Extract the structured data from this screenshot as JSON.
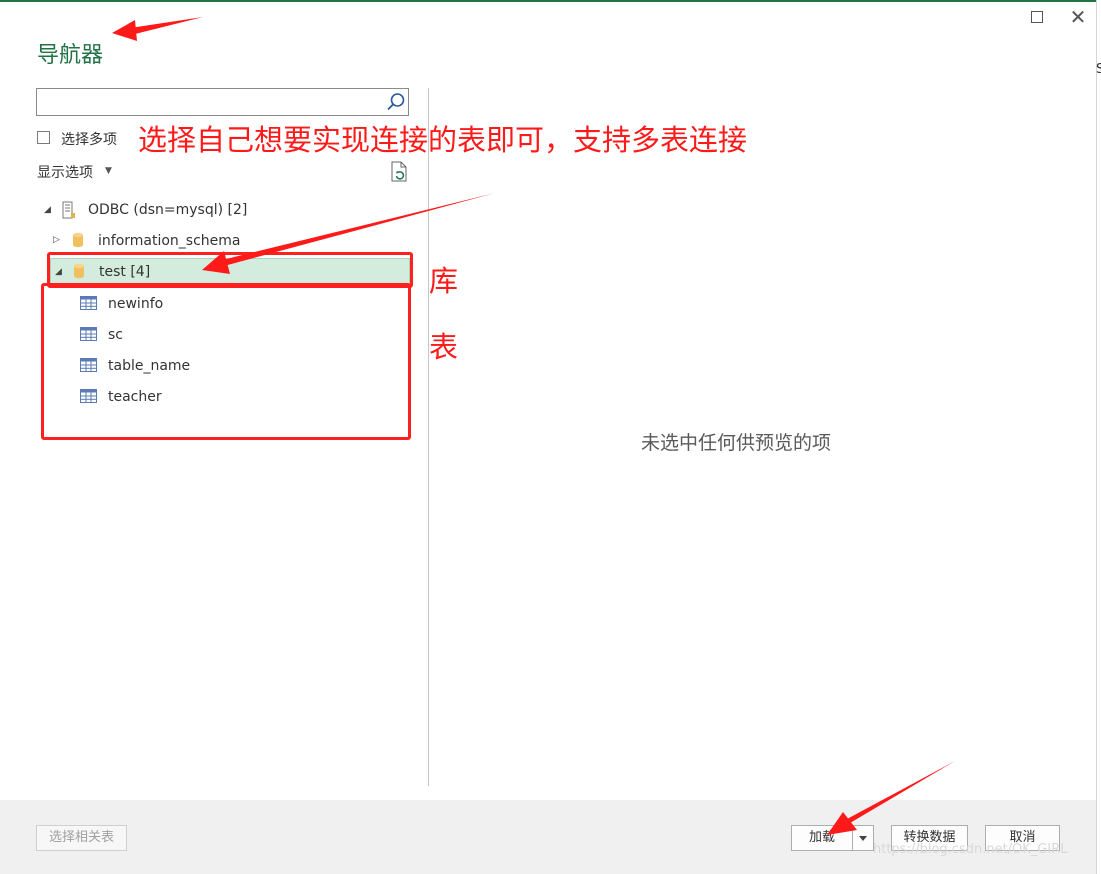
{
  "dialog": {
    "title": "导航器",
    "close_glyph": "✕"
  },
  "search": {
    "placeholder": "",
    "value": ""
  },
  "multi_select": {
    "label": "选择多项",
    "checked": false
  },
  "display_options": {
    "label": "显示选项",
    "caret": "▼"
  },
  "tree": {
    "root": {
      "toggle": "◢",
      "label": "ODBC (dsn=mysql) [2]",
      "icon": "server-icon"
    },
    "databases": [
      {
        "toggle": "▷",
        "label": "information_schema",
        "icon": "database-icon",
        "expanded": false
      },
      {
        "toggle": "◢",
        "label": "test [4]",
        "icon": "database-icon",
        "expanded": true,
        "selected": true
      }
    ],
    "tables": [
      {
        "label": "newinfo",
        "icon": "table-icon"
      },
      {
        "label": "sc",
        "icon": "table-icon"
      },
      {
        "label": "table_name",
        "icon": "table-icon"
      },
      {
        "label": "teacher",
        "icon": "table-icon"
      }
    ]
  },
  "preview": {
    "empty_message": "未选中任何供预览的项"
  },
  "footer": {
    "related_tables_label": "选择相关表",
    "load_label": "加载",
    "transform_label": "转换数据",
    "cancel_label": "取消",
    "watermark": "https://blog.csdn.net/OK_GIRL"
  },
  "annotations": {
    "main_note": "选择自己想要实现连接的表即可，支持多表连接",
    "db_note": "库",
    "table_note": "表",
    "color": "#ff1a1a"
  },
  "background": {
    "edge_letter": "S",
    "accent": "#217346"
  }
}
